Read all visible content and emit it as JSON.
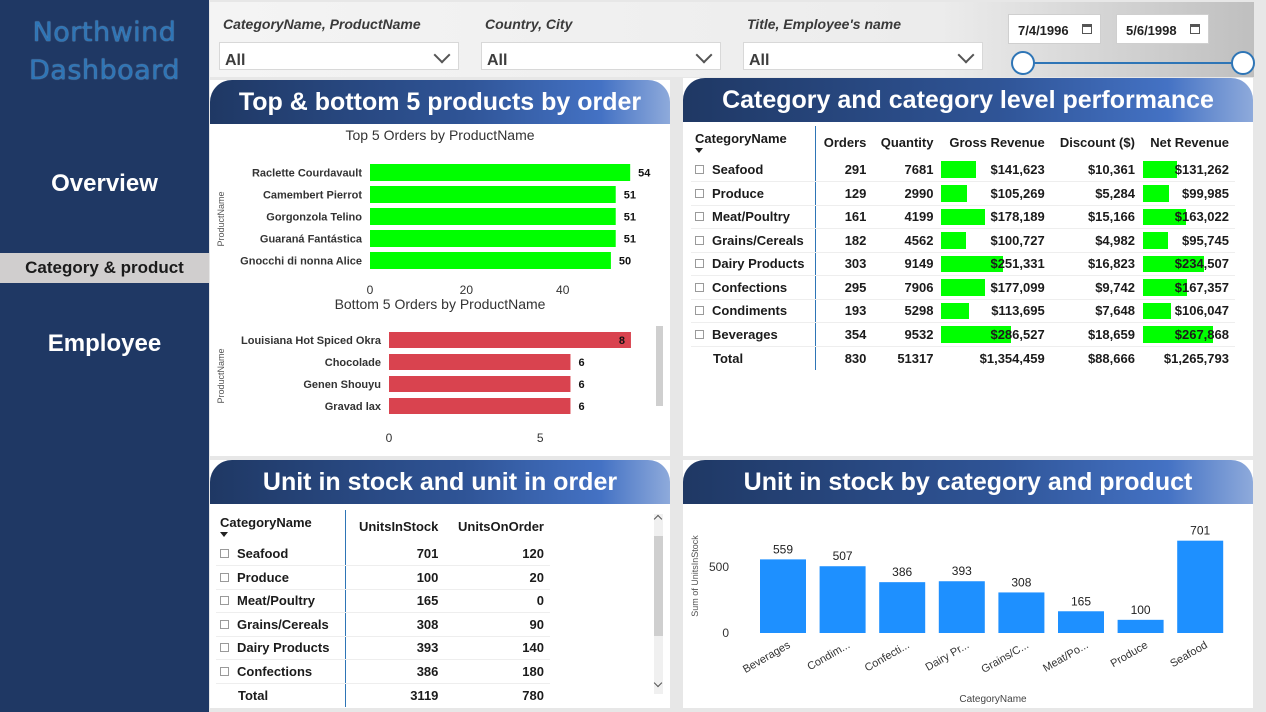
{
  "sidebar": {
    "brand_line1": "Northwind",
    "brand_line2": "Dashboard",
    "nav": [
      {
        "label": "Overview"
      },
      {
        "label": "Category & product"
      },
      {
        "label": "Employee"
      }
    ]
  },
  "filters": {
    "slicers": [
      {
        "title": "CategoryName, ProductName",
        "value": "All"
      },
      {
        "title": "Country, City",
        "value": "All"
      },
      {
        "title": "Title, Employee's name",
        "value": "All"
      }
    ],
    "date_start": "7/4/1996",
    "date_end": "5/6/1998"
  },
  "panels": {
    "top_bottom": {
      "title": "Top & bottom 5 products by order",
      "top_chart_title": "Top 5 Orders by ProductName",
      "bottom_chart_title": "Bottom 5 Orders by ProductName",
      "axis_label": "ProductName"
    },
    "category_perf": {
      "title": "Category and category level performance",
      "columns": [
        "CategoryName",
        "Orders",
        "Quantity",
        "Gross Revenue",
        "Discount ($)",
        "Net Revenue"
      ],
      "rows": [
        {
          "cat": "Seafood",
          "orders": "291",
          "qty": "7681",
          "gross": "$141,623",
          "disc": "$10,361",
          "net": "$131,262",
          "gross_v": 141623,
          "net_v": 131262
        },
        {
          "cat": "Produce",
          "orders": "129",
          "qty": "2990",
          "gross": "$105,269",
          "disc": "$5,284",
          "net": "$99,985",
          "gross_v": 105269,
          "net_v": 99985
        },
        {
          "cat": "Meat/Poultry",
          "orders": "161",
          "qty": "4199",
          "gross": "$178,189",
          "disc": "$15,166",
          "net": "$163,022",
          "gross_v": 178189,
          "net_v": 163022
        },
        {
          "cat": "Grains/Cereals",
          "orders": "182",
          "qty": "4562",
          "gross": "$100,727",
          "disc": "$4,982",
          "net": "$95,745",
          "gross_v": 100727,
          "net_v": 95745
        },
        {
          "cat": "Dairy Products",
          "orders": "303",
          "qty": "9149",
          "gross": "$251,331",
          "disc": "$16,823",
          "net": "$234,507",
          "gross_v": 251331,
          "net_v": 234507
        },
        {
          "cat": "Confections",
          "orders": "295",
          "qty": "7906",
          "gross": "$177,099",
          "disc": "$9,742",
          "net": "$167,357",
          "gross_v": 177099,
          "net_v": 167357
        },
        {
          "cat": "Condiments",
          "orders": "193",
          "qty": "5298",
          "gross": "$113,695",
          "disc": "$7,648",
          "net": "$106,047",
          "gross_v": 113695,
          "net_v": 106047
        },
        {
          "cat": "Beverages",
          "orders": "354",
          "qty": "9532",
          "gross": "$286,527",
          "disc": "$18,659",
          "net": "$267,868",
          "gross_v": 286527,
          "net_v": 267868
        }
      ],
      "total": {
        "cat": "Total",
        "orders": "830",
        "qty": "51317",
        "gross": "$1,354,459",
        "disc": "$88,666",
        "net": "$1,265,793"
      }
    },
    "stock_order": {
      "title": "Unit in stock and unit in order",
      "columns": [
        "CategoryName",
        "UnitsInStock",
        "UnitsOnOrder"
      ],
      "rows": [
        {
          "cat": "Seafood",
          "stock": "701",
          "order": "120"
        },
        {
          "cat": "Produce",
          "stock": "100",
          "order": "20"
        },
        {
          "cat": "Meat/Poultry",
          "stock": "165",
          "order": "0"
        },
        {
          "cat": "Grains/Cereals",
          "stock": "308",
          "order": "90"
        },
        {
          "cat": "Dairy Products",
          "stock": "393",
          "order": "140"
        },
        {
          "cat": "Confections",
          "stock": "386",
          "order": "180"
        }
      ],
      "total": {
        "cat": "Total",
        "stock": "3119",
        "order": "780"
      }
    },
    "stock_chart": {
      "title": "Unit in stock by category and product"
    }
  },
  "colors": {
    "sidebar": "#1f3864",
    "top_bar": "#00ff00",
    "bottom_bar": "#d9434f",
    "stock_bar": "#1e90ff",
    "accent": "#2e75b6"
  },
  "chart_data": [
    {
      "type": "bar",
      "orientation": "horizontal",
      "title": "Top 5 Orders by ProductName",
      "ylabel": "ProductName",
      "categories": [
        "Raclette Courdavault",
        "Camembert Pierrot",
        "Gorgonzola Telino",
        "Guaraná Fantástica",
        "Gnocchi di nonna Alice"
      ],
      "values": [
        54,
        51,
        51,
        51,
        50
      ],
      "xlim": [
        0,
        55
      ],
      "xticks": [
        "0",
        "20",
        "40"
      ]
    },
    {
      "type": "bar",
      "orientation": "horizontal",
      "title": "Bottom 5 Orders by ProductName",
      "ylabel": "ProductName",
      "categories": [
        "Louisiana Hot Spiced Okra",
        "Chocolade",
        "Genen Shouyu",
        "Gravad lax"
      ],
      "values": [
        8,
        6,
        6,
        6
      ],
      "xlim": [
        0,
        8.2
      ],
      "xticks": [
        "0",
        "5"
      ]
    },
    {
      "type": "bar",
      "title": "",
      "xlabel": "CategoryName",
      "ylabel": "Sum of UnitsInStock",
      "categories": [
        "Beverages",
        "Condim...",
        "Confecti...",
        "Dairy Pr...",
        "Grains/C...",
        "Meat/Po...",
        "Produce",
        "Seafood"
      ],
      "values": [
        559,
        507,
        386,
        393,
        308,
        165,
        100,
        701
      ],
      "ylim": [
        0,
        750
      ],
      "yticks": [
        "0",
        "500"
      ]
    }
  ]
}
